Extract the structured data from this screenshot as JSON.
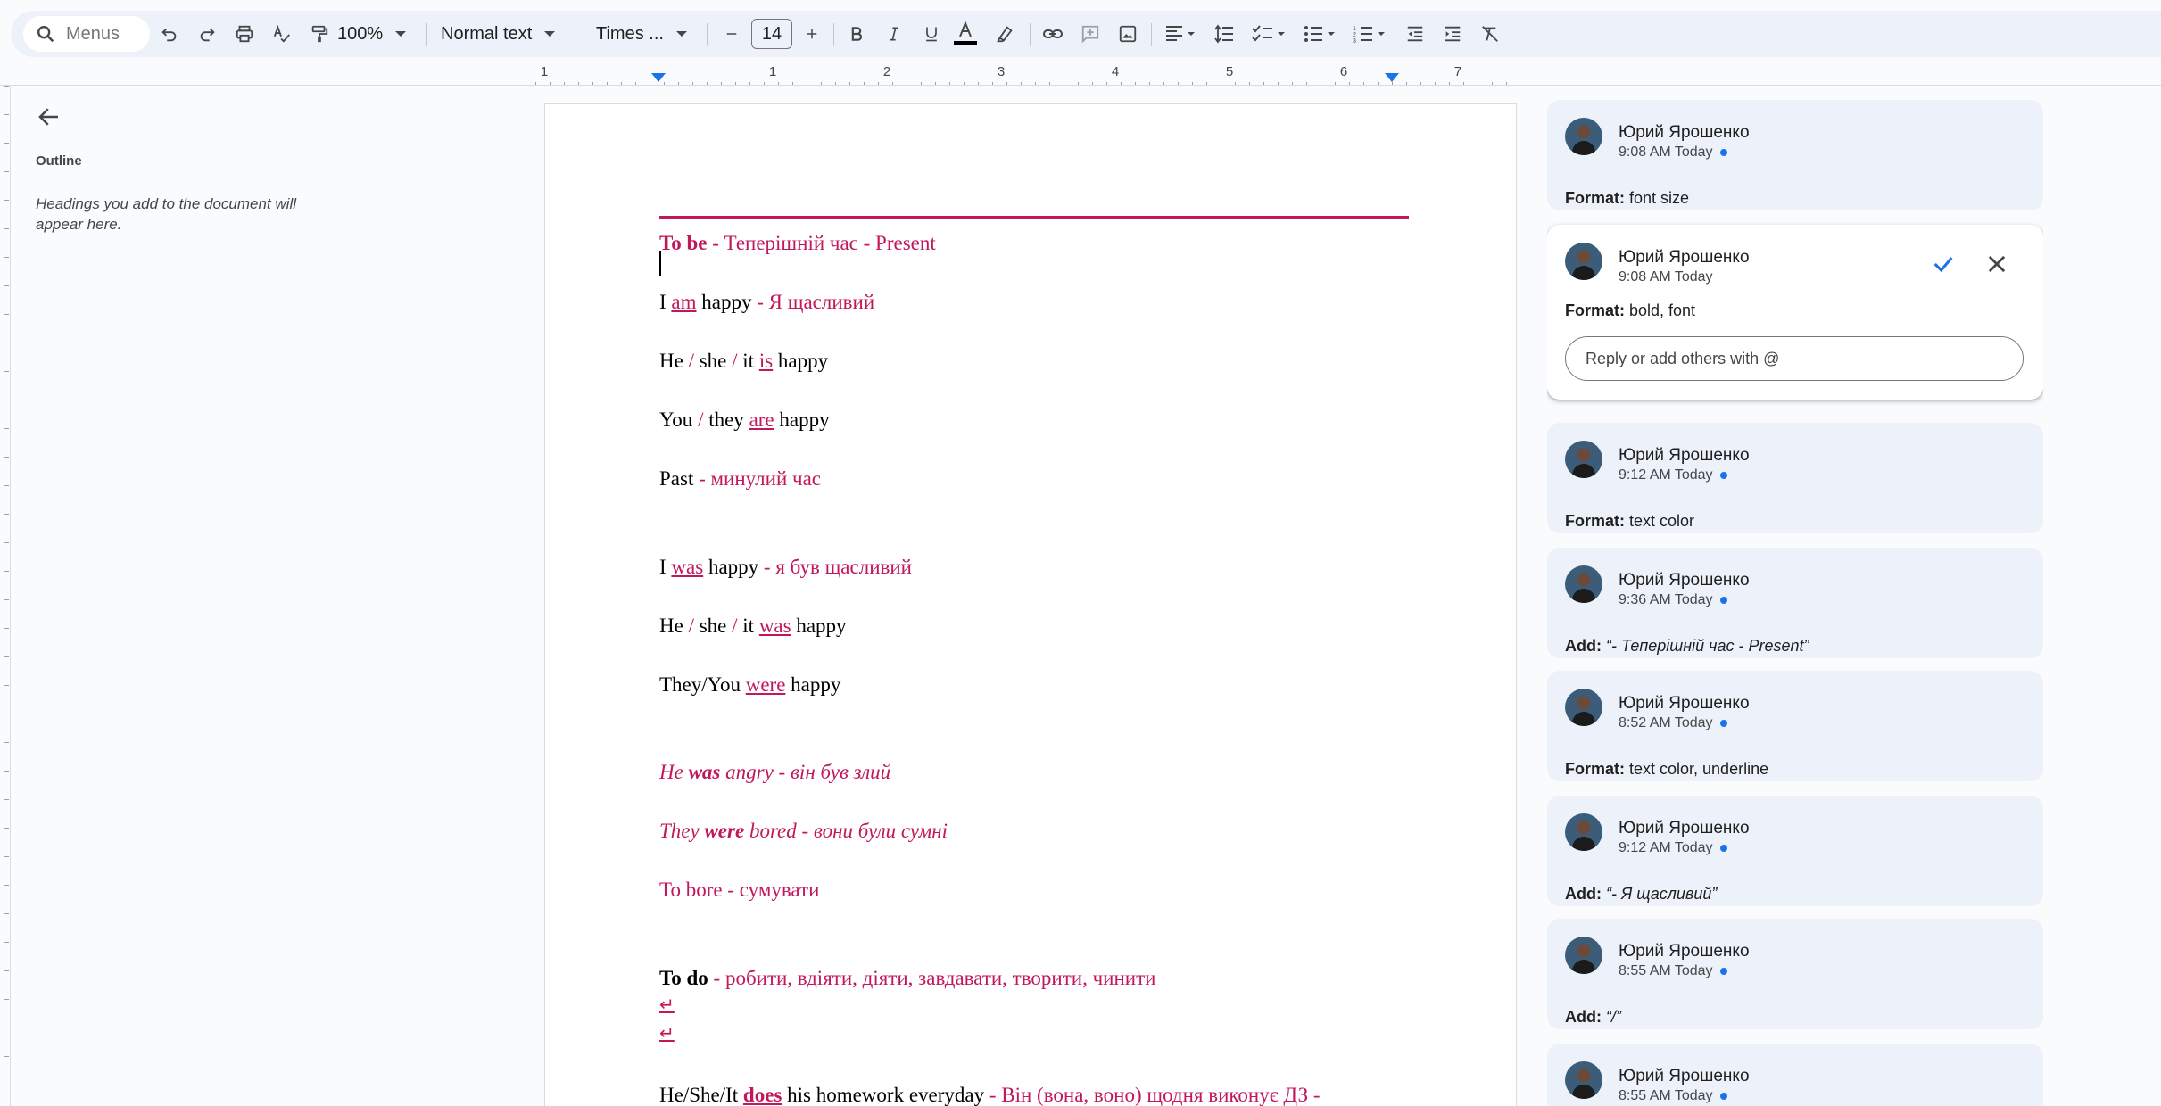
{
  "toolbar": {
    "search_placeholder": "Menus",
    "zoom": "100%",
    "style": "Normal text",
    "font": "Times ...",
    "font_size": "14"
  },
  "ruler": {
    "numbers": [
      "1",
      "1",
      "2",
      "3",
      "4",
      "5",
      "6",
      "7"
    ]
  },
  "outline": {
    "title": "Outline",
    "hint": "Headings you add to the document will appear here."
  },
  "document": {
    "l1_bold": "To be",
    "l1_rest": " - Теперішній час - Present",
    "l2_a": "I ",
    "l2_verb": "am",
    "l2_b": " happy",
    "l2_tr": " - Я щасливий",
    "l3_a": "He",
    "l3_slash1": " / ",
    "l3_b": "she",
    "l3_slash2": " / ",
    "l3_c": "it ",
    "l3_verb": "is",
    "l3_d": " happy",
    "l4_a": "You",
    "l4_slash": " / ",
    "l4_b": "they ",
    "l4_verb": "are",
    "l4_c": " happy",
    "l5_a": "Past",
    "l5_tr": " - минулий час",
    "l6_a": "I ",
    "l6_verb": "was",
    "l6_b": " happy",
    "l6_tr": " - я був щасливий",
    "l7_a": "He",
    "l7_slash1": " / ",
    "l7_b": "she",
    "l7_slash2": " / ",
    "l7_c": "it ",
    "l7_verb": "was",
    "l7_d": " happy",
    "l8_a": "They/You ",
    "l8_verb": "were",
    "l8_b": " happy",
    "l9_a": "He ",
    "l9_verb": "was",
    "l9_b": " angry - він був злий",
    "l10_a": "They ",
    "l10_verb": "were",
    "l10_b": " bored - вони були сумні",
    "l11": "To bore - сумувати",
    "l12_bold": "To do",
    "l12_rest": " - робити, вдіяти, діяти, завдавати, творити, чинити",
    "ret": "↵",
    "l13_a": "He/She/It ",
    "l13_verb": "does",
    "l13_b": " his homework everyday",
    "l13_tr": " - Він (вона, воно) щодня виконує ДЗ -"
  },
  "comments": [
    {
      "name": "Юрий Ярошенко",
      "time": "9:08 AM Today",
      "label": "Format:",
      "text": " font size"
    },
    {
      "name": "Юрий Ярошенко",
      "time": "9:08 AM Today",
      "label": "Format:",
      "text": " bold, font",
      "reply_placeholder": "Reply or add others with @"
    },
    {
      "name": "Юрий Ярошенко",
      "time": "9:12 AM Today",
      "label": "Format:",
      "text": " text color"
    },
    {
      "name": "Юрий Ярошенко",
      "time": "9:36 AM Today",
      "label": "Add:",
      "text": " “- Теперішній час - Present”"
    },
    {
      "name": "Юрий Ярошенко",
      "time": "8:52 AM Today",
      "label": "Format:",
      "text": " text color, underline"
    },
    {
      "name": "Юрий Ярошенко",
      "time": "9:12 AM Today",
      "label": "Add:",
      "text": " “- Я щасливий”"
    },
    {
      "name": "Юрий Ярошенко",
      "time": "8:55 AM Today",
      "label": "Add:",
      "text": " “/”"
    },
    {
      "name": "Юрий Ярошенко",
      "time": "8:55 AM Today"
    }
  ],
  "colors": {
    "accent": "#c2185b",
    "blue": "#1a73e8",
    "toolbar_bg": "#edf2fa"
  }
}
